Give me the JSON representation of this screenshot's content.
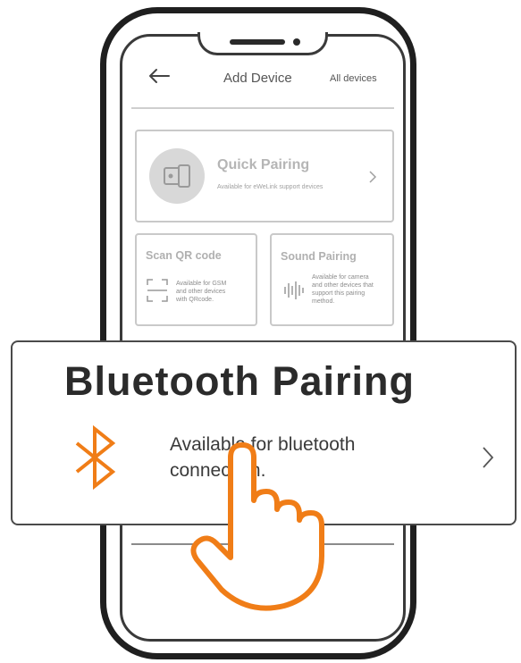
{
  "header": {
    "back_icon": "arrow-left-icon",
    "title": "Add Device",
    "all_devices": "All devices"
  },
  "quick_pairing": {
    "icon": "phone-device-icon",
    "title": "Quick Pairing",
    "subtitle": "Available for eWeLink support devices"
  },
  "scan_qr": {
    "icon": "qr-scan-icon",
    "title": "Scan QR code",
    "desc": [
      "Available for GSM",
      "and other devices",
      "with QRcode."
    ]
  },
  "sound_pairing": {
    "icon": "soundwave-icon",
    "title": "Sound Pairing",
    "desc": [
      "Available for camera",
      "and other devices that",
      "support this pairing",
      "method."
    ]
  },
  "bluetooth_pairing": {
    "icon": "bluetooth-icon",
    "title": "Bluetooth Pairing",
    "desc_line1": "Available for bluetooth",
    "desc_line2": "connection.",
    "accent_color": "#f07d17"
  },
  "pointer": {
    "icon": "hand-pointer-icon",
    "color": "#f07d17"
  }
}
